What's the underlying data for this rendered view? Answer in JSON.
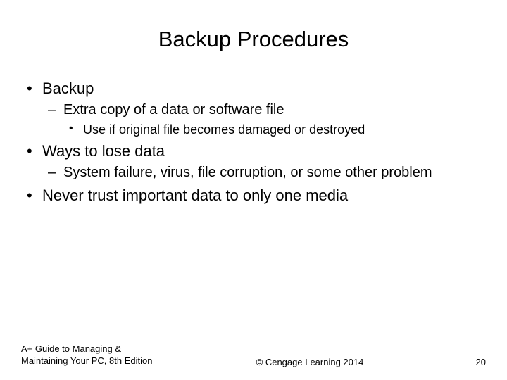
{
  "title": "Backup Procedures",
  "bullets": {
    "b1": "Backup",
    "b1_1": "Extra copy of a data or software file",
    "b1_1_1": "Use if original file becomes damaged or destroyed",
    "b2": "Ways to lose data",
    "b2_1": "System failure, virus, file corruption, or some other problem",
    "b3": "Never trust important data to only one media"
  },
  "footer": {
    "left": "A+ Guide to Managing & Maintaining Your PC, 8th Edition",
    "center": "© Cengage Learning  2014",
    "page": "20"
  }
}
